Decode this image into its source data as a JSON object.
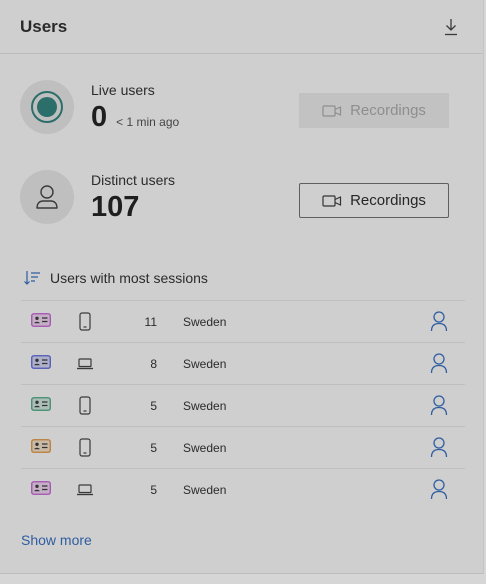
{
  "header": {
    "title": "Users",
    "download_icon": "download-icon"
  },
  "live": {
    "label": "Live users",
    "value": "0",
    "sub": "< 1 min ago",
    "recordings_label": "Recordings",
    "recordings_disabled": true
  },
  "distinct": {
    "label": "Distinct users",
    "value": "107",
    "recordings_label": "Recordings"
  },
  "sessions": {
    "title": "Users with most sessions",
    "rows": [
      {
        "type_color": "#a24fb0",
        "device": "mobile",
        "count": "11",
        "country": "Sweden"
      },
      {
        "type_color": "#4c55b8",
        "device": "desktop",
        "count": "8",
        "country": "Sweden"
      },
      {
        "type_color": "#3f8a6e",
        "device": "mobile",
        "count": "5",
        "country": "Sweden"
      },
      {
        "type_color": "#b97b33",
        "device": "mobile",
        "count": "5",
        "country": "Sweden"
      },
      {
        "type_color": "#a24fb0",
        "device": "desktop",
        "count": "5",
        "country": "Sweden"
      }
    ]
  },
  "show_more_label": "Show more",
  "colors": {
    "accent": "#2f5da0",
    "live_ring": "#2c6e69"
  }
}
